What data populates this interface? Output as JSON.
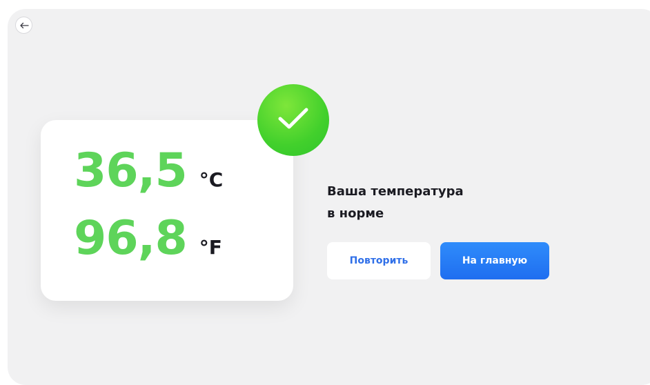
{
  "nav": {
    "back_icon": "arrow-left-icon"
  },
  "readings": {
    "celsius": {
      "value": "36,5",
      "unit": "°C"
    },
    "fahrenheit": {
      "value": "96,8",
      "unit": "°F"
    }
  },
  "status": {
    "icon": "checkmark-icon",
    "line1": "Ваша температура",
    "line2": "в норме"
  },
  "actions": {
    "retry_label": "Повторить",
    "home_label": "На главную"
  },
  "colors": {
    "value_green": "#5ed45a",
    "badge_green": "#42d02c",
    "primary_blue": "#1f6ef0",
    "background": "#f1f1f2"
  }
}
